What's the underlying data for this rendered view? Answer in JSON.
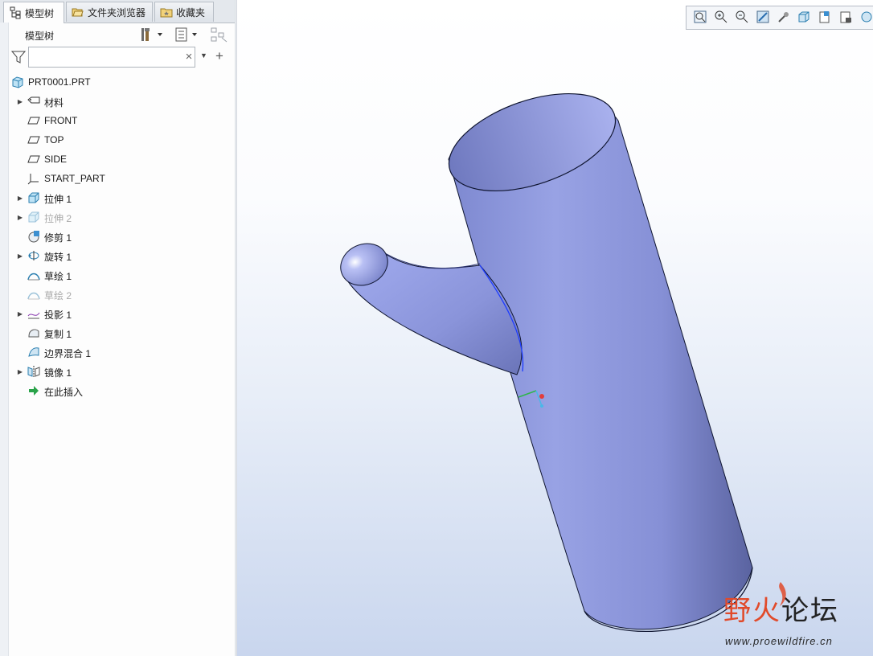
{
  "tabs": [
    {
      "label": "模型树",
      "icon": "tree-icon",
      "active": true
    },
    {
      "label": "文件夹浏览器",
      "icon": "folder-browser-icon",
      "active": false
    },
    {
      "label": "收藏夹",
      "icon": "favorites-icon",
      "active": false
    }
  ],
  "tree_header": {
    "title": "模型树",
    "buttons": [
      "settings-tools-icon",
      "show-options-icon",
      "tree-columns-icon"
    ]
  },
  "search": {
    "value": "",
    "placeholder": "",
    "clear": "×"
  },
  "model_tree": {
    "root": "PRT0001.PRT",
    "items": [
      {
        "label": "材料",
        "icon": "material-icon",
        "expandable": true,
        "dim": false
      },
      {
        "label": "FRONT",
        "icon": "datum-plane-icon",
        "expandable": false,
        "dim": false
      },
      {
        "label": "TOP",
        "icon": "datum-plane-icon",
        "expandable": false,
        "dim": false
      },
      {
        "label": "SIDE",
        "icon": "datum-plane-icon",
        "expandable": false,
        "dim": false
      },
      {
        "label": "START_PART",
        "icon": "coordinate-system-icon",
        "expandable": false,
        "dim": false
      },
      {
        "label": "拉伸 1",
        "icon": "extrude-icon",
        "expandable": true,
        "dim": false
      },
      {
        "label": "拉伸 2",
        "icon": "extrude-icon",
        "expandable": true,
        "dim": true
      },
      {
        "label": "修剪 1",
        "icon": "trim-icon",
        "expandable": false,
        "dim": false
      },
      {
        "label": "旋转 1",
        "icon": "revolve-icon",
        "expandable": true,
        "dim": false
      },
      {
        "label": "草绘 1",
        "icon": "sketch-icon",
        "expandable": false,
        "dim": false
      },
      {
        "label": "草绘 2",
        "icon": "sketch-icon",
        "expandable": false,
        "dim": true
      },
      {
        "label": "投影 1",
        "icon": "project-icon",
        "expandable": true,
        "dim": false
      },
      {
        "label": "复制 1",
        "icon": "copy-icon",
        "expandable": false,
        "dim": false
      },
      {
        "label": "边界混合 1",
        "icon": "boundary-blend-icon",
        "expandable": false,
        "dim": false
      },
      {
        "label": "镜像 1",
        "icon": "mirror-icon",
        "expandable": true,
        "dim": false
      },
      {
        "label": "在此插入",
        "icon": "insert-here-icon",
        "expandable": false,
        "dim": false
      }
    ]
  },
  "view_toolbar": [
    "refit-icon",
    "zoom-in-icon",
    "zoom-out-icon",
    "repaint-icon",
    "spin-center-icon",
    "display-style-icon",
    "saved-orientations-icon",
    "view-manager-icon",
    "more-icon"
  ],
  "watermark": {
    "title_part1": "野火",
    "title_part2": "论坛",
    "url": "www.proewildfire.cn"
  },
  "colors": {
    "model_fill": "#8c97dc",
    "model_edge": "#101838",
    "watermark_red": "#e14a2a",
    "watermark_dark": "#222222"
  }
}
